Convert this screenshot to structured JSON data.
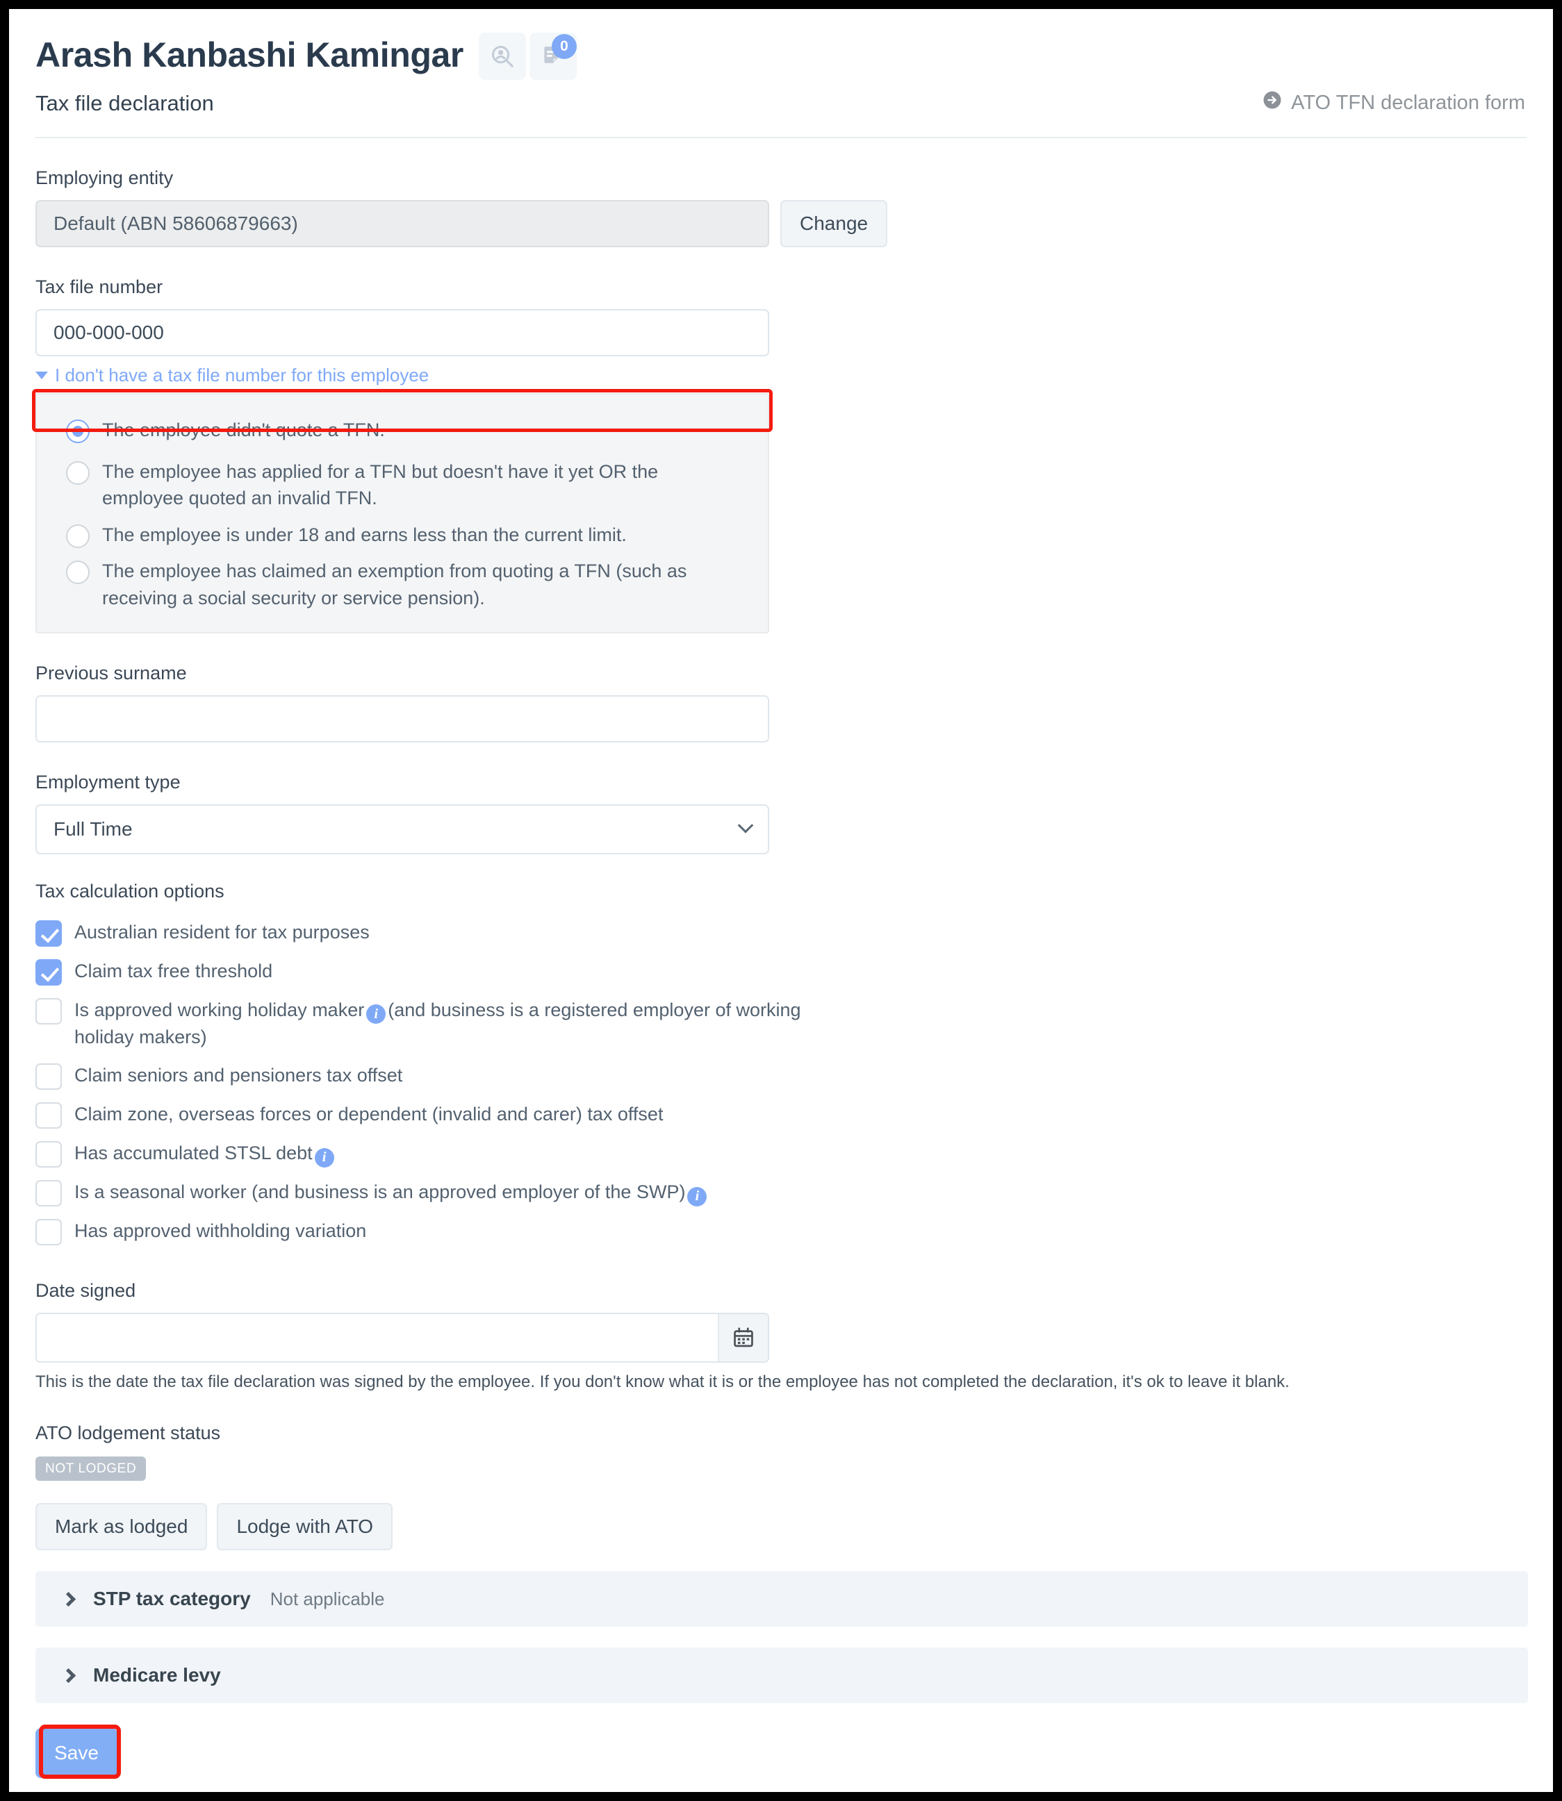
{
  "header": {
    "employee_name": "Arash Kanbashi Kamingar",
    "subtitle": "Tax file declaration",
    "icons": {
      "person_search": "person-search-icon",
      "notes": "notes-document-icon",
      "notes_badge": "0"
    },
    "ato_link": "ATO TFN declaration form"
  },
  "employing_entity": {
    "label": "Employing entity",
    "value": "Default (ABN 58606879663)",
    "change_button": "Change"
  },
  "tax_file_number": {
    "label": "Tax file number",
    "value": "000-000-000",
    "disclosure": "I don't have a tax file number for this employee",
    "options": [
      "The employee didn't quote a TFN.",
      "The employee has applied for a TFN but doesn't have it yet OR the employee quoted an invalid TFN.",
      "The employee is under 18 and earns less than the current limit.",
      "The employee has claimed an exemption from quoting a TFN (such as receiving a social security or service pension)."
    ],
    "selected_index": 0
  },
  "previous_surname": {
    "label": "Previous surname",
    "value": "",
    "placeholder": ""
  },
  "employment_type": {
    "label": "Employment type",
    "value": "Full Time"
  },
  "tax_calculation_options": {
    "label": "Tax calculation options",
    "items": [
      {
        "text": "Australian resident for tax purposes",
        "checked": true,
        "info": false
      },
      {
        "text": "Claim tax free threshold",
        "checked": true,
        "info": false
      },
      {
        "text_before": "Is approved working holiday maker",
        "text_after": "(and business is a registered employer of working holiday makers)",
        "checked": false,
        "info": true
      },
      {
        "text": "Claim seniors and pensioners tax offset",
        "checked": false,
        "info": false
      },
      {
        "text": "Claim zone, overseas forces or dependent (invalid and carer) tax offset",
        "checked": false,
        "info": false
      },
      {
        "text_before": "Has accumulated STSL debt",
        "text_after": "",
        "checked": false,
        "info": true
      },
      {
        "text_before": "Is a seasonal worker (and business is an approved employer of the SWP)",
        "text_after": "",
        "checked": false,
        "info": true
      },
      {
        "text": "Has approved withholding variation",
        "checked": false,
        "info": false
      }
    ]
  },
  "date_signed": {
    "label": "Date signed",
    "value": "",
    "placeholder": "",
    "calendar_icon": "calendar-icon",
    "helper": "This is the date the tax file declaration was signed by the employee. If you don't know what it is or the employee has not completed the declaration, it's ok to leave it blank."
  },
  "ato_lodgement": {
    "label": "ATO lodgement status",
    "status_badge": "NOT LODGED",
    "mark_as_lodged": "Mark as lodged",
    "lodge_with_ato": "Lodge with ATO"
  },
  "accordions": [
    {
      "title": "STP tax category",
      "value": "Not applicable"
    },
    {
      "title": "Medicare levy",
      "value": ""
    }
  ],
  "save_button": "Save",
  "colors": {
    "accent_blue": "#7fa9f7",
    "save_blue": "#82aef5",
    "highlight_red": "#f41b10",
    "badge_grey": "#b9c2cc",
    "panel_grey": "#f4f5f6",
    "accordion_grey": "#f1f4f8"
  }
}
